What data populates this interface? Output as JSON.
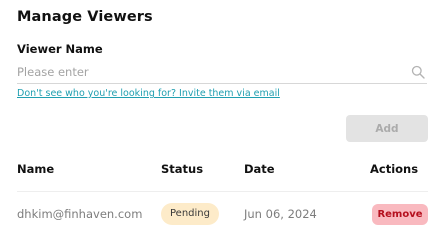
{
  "page": {
    "title": "Manage Viewers"
  },
  "viewer_field": {
    "label": "Viewer Name",
    "placeholder": "Please enter",
    "value": "",
    "icon": "search-icon"
  },
  "invite_link": "Don't see who you're looking for? Invite them via email",
  "add_button": {
    "label": "Add",
    "disabled": true
  },
  "table": {
    "columns": {
      "name": "Name",
      "status": "Status",
      "date": "Date",
      "actions": "Actions"
    },
    "rows": [
      {
        "name": "dhkim@finhaven.com",
        "status": "Pending",
        "date": "Jun 06, 2024",
        "action": "Remove"
      }
    ]
  },
  "colors": {
    "link": "#1f9fb0",
    "pending_badge_bg": "#fdebc9",
    "remove_button_bg": "#f9b9bf",
    "remove_button_text": "#b5101e",
    "disabled_button_bg": "#e3e3e3"
  }
}
